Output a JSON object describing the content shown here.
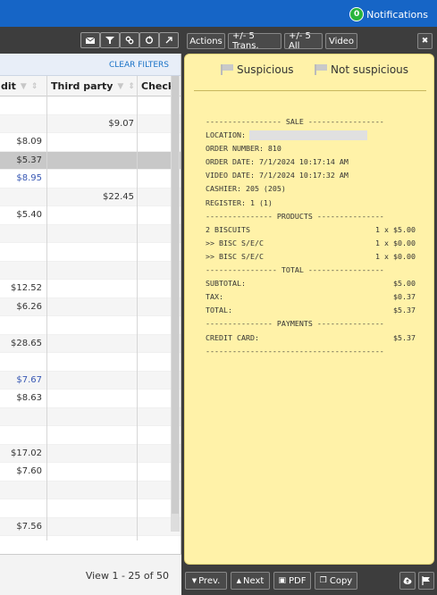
{
  "topbar": {
    "notifications_label": "Notifications",
    "notifications_count": "0"
  },
  "grid": {
    "clear_filters": "CLEAR FILTERS",
    "columns": [
      "dit",
      "Third party",
      "Check"
    ],
    "rows": [
      {
        "c1": "",
        "c2": ""
      },
      {
        "c1": "",
        "c2": "$9.07"
      },
      {
        "c1": "$8.09",
        "c2": ""
      },
      {
        "c1": "$5.37",
        "c2": ""
      },
      {
        "c1": "$8.95",
        "c2": ""
      },
      {
        "c1": "",
        "c2": "$22.45"
      },
      {
        "c1": "$5.40",
        "c2": ""
      },
      {
        "c1": "",
        "c2": ""
      },
      {
        "c1": "",
        "c2": ""
      },
      {
        "c1": "",
        "c2": ""
      },
      {
        "c1": "$12.52",
        "c2": ""
      },
      {
        "c1": "$6.26",
        "c2": ""
      },
      {
        "c1": "",
        "c2": ""
      },
      {
        "c1": "$28.65",
        "c2": ""
      },
      {
        "c1": "",
        "c2": ""
      },
      {
        "c1": "$7.67",
        "c2": ""
      },
      {
        "c1": "$8.63",
        "c2": ""
      },
      {
        "c1": "",
        "c2": ""
      },
      {
        "c1": "",
        "c2": ""
      },
      {
        "c1": "$17.02",
        "c2": ""
      },
      {
        "c1": "$7.60",
        "c2": ""
      },
      {
        "c1": "",
        "c2": ""
      },
      {
        "c1": "",
        "c2": ""
      },
      {
        "c1": "$7.56",
        "c2": ""
      }
    ],
    "view_text": "View 1 - 25 of 50"
  },
  "toolbar_right": {
    "actions": "Actions",
    "plus5trans": "+/- 5 Trans.",
    "plus5all": "+/- 5 All",
    "video": "Video",
    "close": "✖"
  },
  "panel": {
    "suspicious": "Suspicious",
    "not_suspicious": "Not suspicious",
    "receipt": [
      {
        "l": "----------------- SALE -----------------",
        "r": ""
      },
      {
        "l": "LOCATION:",
        "r": "",
        "blur": true
      },
      {
        "l": "ORDER NUMBER: 810",
        "r": ""
      },
      {
        "l": "ORDER DATE: 7/1/2024 10:17:14 AM",
        "r": ""
      },
      {
        "l": "VIDEO DATE: 7/1/2024 10:17:32 AM",
        "r": ""
      },
      {
        "l": "CASHIER: 205 (205)",
        "r": ""
      },
      {
        "l": "REGISTER: 1 (1)",
        "r": ""
      },
      {
        "l": "--------------- PRODUCTS ---------------",
        "r": ""
      },
      {
        "l": "2 BISCUITS",
        "r": "1 x $5.00"
      },
      {
        "l": ">> BISC S/E/C",
        "r": "1 x $0.00"
      },
      {
        "l": ">> BISC S/E/C",
        "r": "1 x $0.00"
      },
      {
        "l": "---------------- TOTAL -----------------",
        "r": ""
      },
      {
        "l": "SUBTOTAL:",
        "r": "$5.00"
      },
      {
        "l": "TAX:",
        "r": "$0.37"
      },
      {
        "l": "TOTAL:",
        "r": "$5.37"
      },
      {
        "l": "--------------- PAYMENTS ---------------",
        "r": ""
      },
      {
        "l": "CREDIT CARD:",
        "r": "$5.37"
      },
      {
        "l": "----------------------------------------",
        "r": ""
      }
    ]
  },
  "bottom": {
    "prev": "Prev.",
    "next": "Next",
    "pdf": "PDF",
    "copy": "Copy"
  }
}
